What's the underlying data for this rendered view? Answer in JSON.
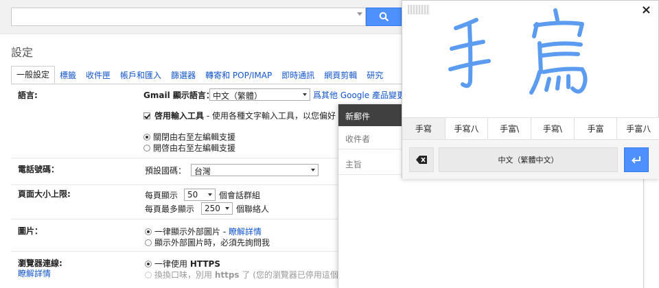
{
  "search": {
    "value": ""
  },
  "settings": {
    "title": "設定",
    "tabs": [
      "一般設定",
      "標籤",
      "收件匣",
      "帳戶和匯入",
      "篩選器",
      "轉寄和 POP/IMAP",
      "即時通訊",
      "網頁剪輯",
      "研究"
    ]
  },
  "rows": {
    "language": {
      "label": "語言:",
      "display_label_bold": "Gmail",
      "display_label": " 顯示語言：",
      "select_value": "中文（繁體）",
      "more_link": "爲其他 Google 產品變更",
      "input_tools_bold": "啓用輸入工具",
      "input_tools_text": " - 使用各種文字輸入工具，以您偏好",
      "rtl_off": "關閉由右至左編輯支援",
      "rtl_on": "開啓由右至左編輯支援"
    },
    "phone": {
      "label": "電話號碼：",
      "country_label": "預設國碼：",
      "country_value": "台灣"
    },
    "page_size": {
      "label": "頁面大小上限:",
      "conv_prefix": "每頁顯示",
      "conv_value": "50",
      "conv_suffix": "個會話群組",
      "contact_prefix": "每頁最多顯示",
      "contact_value": "250",
      "contact_suffix": "個聯絡人"
    },
    "images": {
      "label": "圖片：",
      "always_text": "一律顯示外部圖片 - ",
      "always_link": "瞭解詳情",
      "ask_text": "顯示外部圖片時，必須先詢問我"
    },
    "browser": {
      "label": "瀏覽器連線:",
      "sublink": "瞭解詳情",
      "https_prefix": "一律使用 ",
      "https_bold": "HTTPS",
      "alt_text": "換換口味，別用 ",
      "alt_bold": "https",
      "alt_suffix": " 了 (您的瀏覽器已停用這個選"
    }
  },
  "compose": {
    "title": "新郵件",
    "to_placeholder": "收件者",
    "subject_placeholder": "主旨"
  },
  "handwriting": {
    "candidates": [
      "手寫",
      "手寫八",
      "手富\\",
      "手寫\\",
      "手富",
      "手富八"
    ],
    "language_button": "中文（繁體中文）",
    "stroke_color": "#5b9cf0"
  },
  "colors": {
    "accent": "#4d90fe",
    "link": "#1155cc",
    "compose_header": "#404040"
  }
}
